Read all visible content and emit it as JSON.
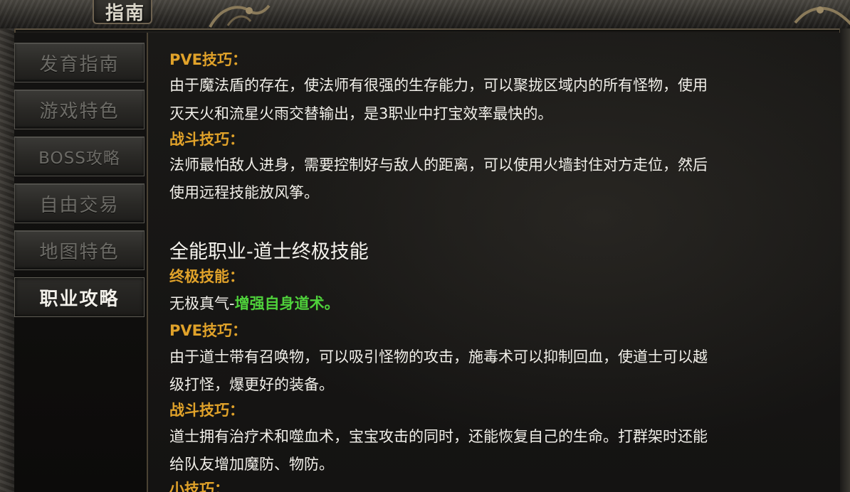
{
  "window": {
    "title": "指南"
  },
  "sidebar": {
    "items": [
      {
        "label": "发育指南",
        "active": false
      },
      {
        "label": "游戏特色",
        "active": false
      },
      {
        "label": "BOSS攻略",
        "active": false
      },
      {
        "label": "自由交易",
        "active": false
      },
      {
        "label": "地图特色",
        "active": false
      },
      {
        "label": "职业攻略",
        "active": true
      }
    ]
  },
  "content": {
    "mage": {
      "pve_label": "PVE技巧：",
      "pve_line1": "由于魔法盾的存在，使法师有很强的生存能力，可以聚拢区域内的所有怪物，使用",
      "pve_line2": "灭天火和流星火雨交替输出，是3职业中打宝效率最快的。",
      "combat_label": "战斗技巧：",
      "combat_line1": "法师最怕敌人进身，需要控制好与敌人的距离，可以使用火墙封住对方走位，然后",
      "combat_line2": "使用远程技能放风筝。"
    },
    "taoist": {
      "heading": "全能职业-道士终极技能",
      "ultimate_label": "终极技能：",
      "ultimate_prefix": "无极真气-",
      "ultimate_effect": "增强自身道术。",
      "pve_label": "PVE技巧：",
      "pve_line1": "由于道士带有召唤物，可以吸引怪物的攻击，施毒术可以抑制回血，使道士可以越",
      "pve_line2": "级打怪，爆更好的装备。",
      "combat_label": "战斗技巧：",
      "combat_line1": "道士拥有治疗术和噬血术，宝宝攻击的同时，还能恢复自己的生命。打群架时还能",
      "combat_line2": "给队友增加魔防、物防。",
      "tips_label": "小技巧："
    }
  },
  "colors": {
    "gold_label": "#e0a22a",
    "body_text": "#f1efe9",
    "highlight_green": "#4fd13b",
    "inactive_nav_text": "#6c6b66"
  },
  "icons": {
    "ornament_left": "dragon-ornament-icon",
    "ornament_right": "dragon-ornament-icon"
  }
}
